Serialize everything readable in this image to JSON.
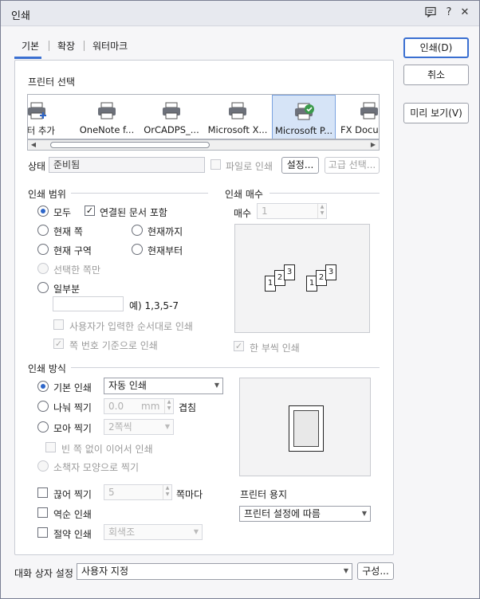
{
  "window": {
    "title": "인쇄",
    "icons": [
      "comment-icon",
      "help-icon",
      "close-icon"
    ],
    "help_glyph": "?",
    "close_glyph": "✕"
  },
  "tabs": [
    {
      "label": "기본",
      "active": true
    },
    {
      "label": "확장",
      "active": false
    },
    {
      "label": "워터마크",
      "active": false
    }
  ],
  "side_buttons": {
    "print": "인쇄(D)",
    "cancel": "취소",
    "preview": "미리 보기(V)"
  },
  "printer_select": {
    "heading": "프린터 선택",
    "items": [
      {
        "label": "린터 추가",
        "icon": "add-printer-icon"
      },
      {
        "label": "OneNote f...",
        "icon": "printer-icon"
      },
      {
        "label": "OrCADPS_...",
        "icon": "printer-icon"
      },
      {
        "label": "Microsoft X...",
        "icon": "printer-icon"
      },
      {
        "label": "Microsoft P...",
        "icon": "printer-default-icon",
        "selected": true
      },
      {
        "label": "FX DocuP",
        "icon": "printer-icon"
      }
    ],
    "status_label": "상태",
    "status_value": "준비됨",
    "print_to_file": "파일로 인쇄",
    "settings_button": "설정...",
    "advanced_button": "고급 선택..."
  },
  "print_range": {
    "heading": "인쇄 범위",
    "all": "모두",
    "include_linked": "연결된 문서 포함",
    "current_page": "현재 쪽",
    "to_current": "현재까지",
    "current_section": "현재 구역",
    "from_current": "현재부터",
    "selection_only": "선택한 쪽만",
    "some_pages": "일부분",
    "example": "예) 1,3,5-7",
    "user_order": "사용자가 입력한 순서대로 인쇄",
    "page_number_based": "쪽 번호 기준으로 인쇄"
  },
  "copies": {
    "heading": "인쇄 매수",
    "label": "매수",
    "value": "1",
    "collate": "한 부씩 인쇄",
    "collate_checked": true
  },
  "print_method": {
    "heading": "인쇄 방식",
    "basic": "기본 인쇄",
    "basic_select": "자동 인쇄",
    "split": "나눠 찍기",
    "split_value": "0.0",
    "split_unit": "mm",
    "overlap": "겹침",
    "gather": "모아 찍기",
    "gather_select": "2쪽씩",
    "no_gap": "빈 쪽 없이 이어서 인쇄",
    "booklet": "소책자 모양으로 찍기",
    "cut": "끊어 찍기",
    "cut_value": "5",
    "per_page": "쪽마다",
    "reverse": "역순 인쇄",
    "saving": "절약 인쇄",
    "saving_select": "회색조",
    "paper_label": "프린터 용지",
    "paper_select": "프린터 설정에 따름"
  },
  "preview_pages": [
    "1",
    "2",
    "3"
  ],
  "footer": {
    "label": "대화 상자 설정",
    "select": "사용자 지정",
    "configure": "구성..."
  },
  "colors": {
    "accent": "#3a6fd1",
    "selected_bg": "#d6e4f7",
    "check_badge": "#3b9a4c"
  }
}
